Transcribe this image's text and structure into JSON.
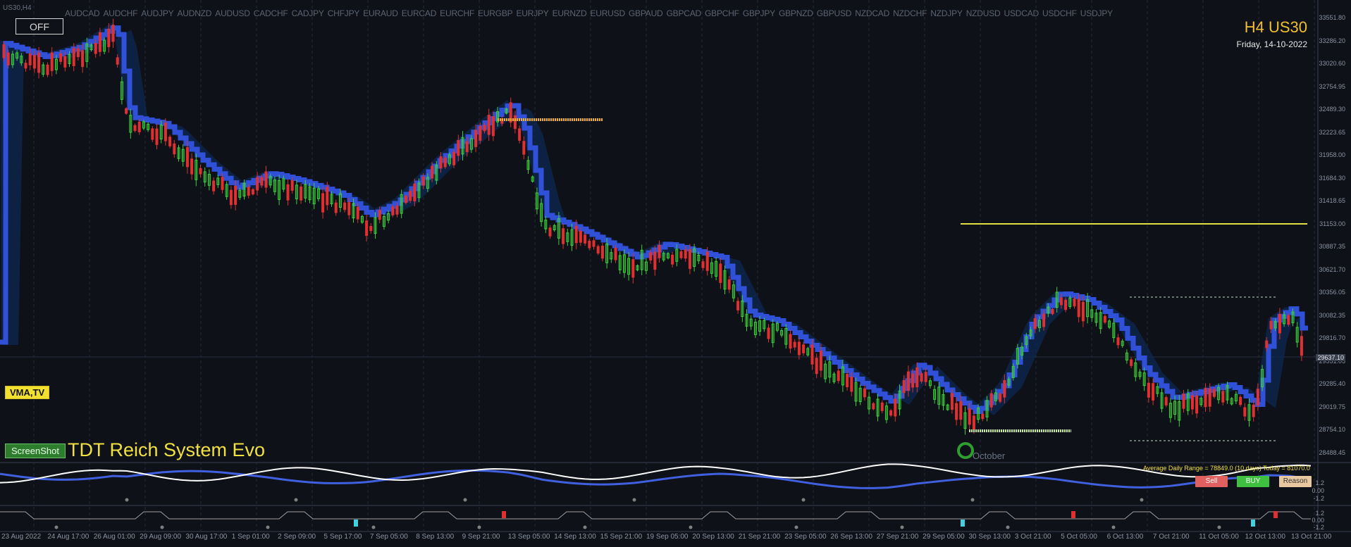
{
  "window": {
    "title": "US30,H4"
  },
  "pairs": [
    "AUDCAD",
    "AUDCHF",
    "AUDJPY",
    "AUDNZD",
    "AUDUSD",
    "CADCHF",
    "CADJPY",
    "CHFJPY",
    "EURAUD",
    "EURCAD",
    "EURCHF",
    "EURGBP",
    "EURJPY",
    "EURNZD",
    "EURUSD",
    "GBPAUD",
    "GBPCAD",
    "GBPCHF",
    "GBPJPY",
    "GBPNZD",
    "GBPUSD",
    "NZDCAD",
    "NZDCHF",
    "NZDJPY",
    "NZDUSD",
    "USDCAD",
    "USDCHF",
    "USDJPY"
  ],
  "off_button": "OFF",
  "symbol": {
    "title": "H4 US30",
    "date": "Friday, 14-10-2022"
  },
  "price_axis": [
    "33551.80",
    "33286.20",
    "33020.60",
    "32754.95",
    "32489.30",
    "32223.65",
    "31958.00",
    "31684.30",
    "31418.65",
    "31153.00",
    "30887.35",
    "30621.70",
    "30356.05",
    "30082.35",
    "29816.70",
    "29551.05",
    "29285.40",
    "29019.75",
    "28754.10",
    "28488.45"
  ],
  "current_price": "29637.10",
  "vma_label": "VMA,TV",
  "screenshot_button": "ScreenShot",
  "system_title": "TDT Reich System Evo",
  "month_label": "October",
  "adr": "Average Daily Range = 78849.0 (10 days)   Today = 81070.0",
  "buttons": {
    "sell": "Sell",
    "buy": "BUY",
    "hedge": "Reason"
  },
  "indicator1_levels": [
    "1.2",
    "0.00",
    "-1.2"
  ],
  "indicator2_levels": [
    "1.2",
    "0.00",
    "-1.2"
  ],
  "time_axis": [
    "23 Aug 2022",
    "24 Aug 17:00",
    "26 Aug 01:00",
    "29 Aug 09:00",
    "30 Aug 17:00",
    "1 Sep 01:00",
    "2 Sep 09:00",
    "5 Sep 17:00",
    "7 Sep 05:00",
    "8 Sep 13:00",
    "9 Sep 21:00",
    "13 Sep 05:00",
    "14 Sep 13:00",
    "15 Sep 21:00",
    "19 Sep 05:00",
    "20 Sep 13:00",
    "21 Sep 21:00",
    "23 Sep 05:00",
    "26 Sep 13:00",
    "27 Sep 21:00",
    "29 Sep 05:00",
    "30 Sep 13:00",
    "3 Oct 21:00",
    "5 Oct 05:00",
    "6 Oct 13:00",
    "7 Oct 21:00",
    "11 Oct 05:00",
    "12 Oct 13:00",
    "13 Oct 21:00"
  ],
  "colors": {
    "background": "#0f1118",
    "bull": "#3ccf3c",
    "bear": "#e03030",
    "vma": "#3050d8",
    "title": "#f0e040"
  }
}
